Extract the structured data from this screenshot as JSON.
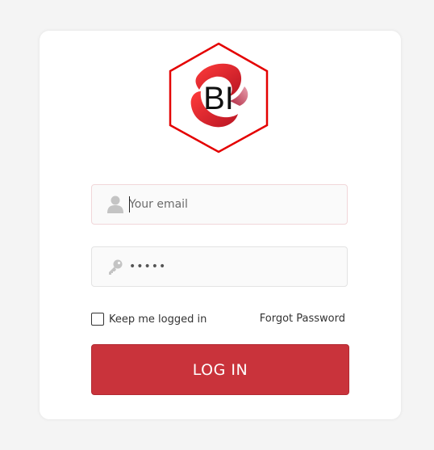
{
  "logo": {
    "text": "BI",
    "icon": "bi-hexagon-logo",
    "colors": {
      "hex_border": "#e40000",
      "swoosh_primary": "#e51b1b",
      "swoosh_secondary": "#c03048"
    }
  },
  "form": {
    "email": {
      "placeholder": "Your email",
      "value": "",
      "icon": "user-icon"
    },
    "password": {
      "masked_value": "•••••",
      "icon": "key-icon"
    },
    "remember": {
      "label": "Keep me logged in",
      "checked": false
    },
    "forgot_label": "Forgot Password",
    "submit_label": "LOG IN"
  },
  "colors": {
    "page_background": "#f4f4f4",
    "card_background": "#ffffff",
    "button": "#c9333b",
    "icon_gray": "#c4c4c4"
  }
}
